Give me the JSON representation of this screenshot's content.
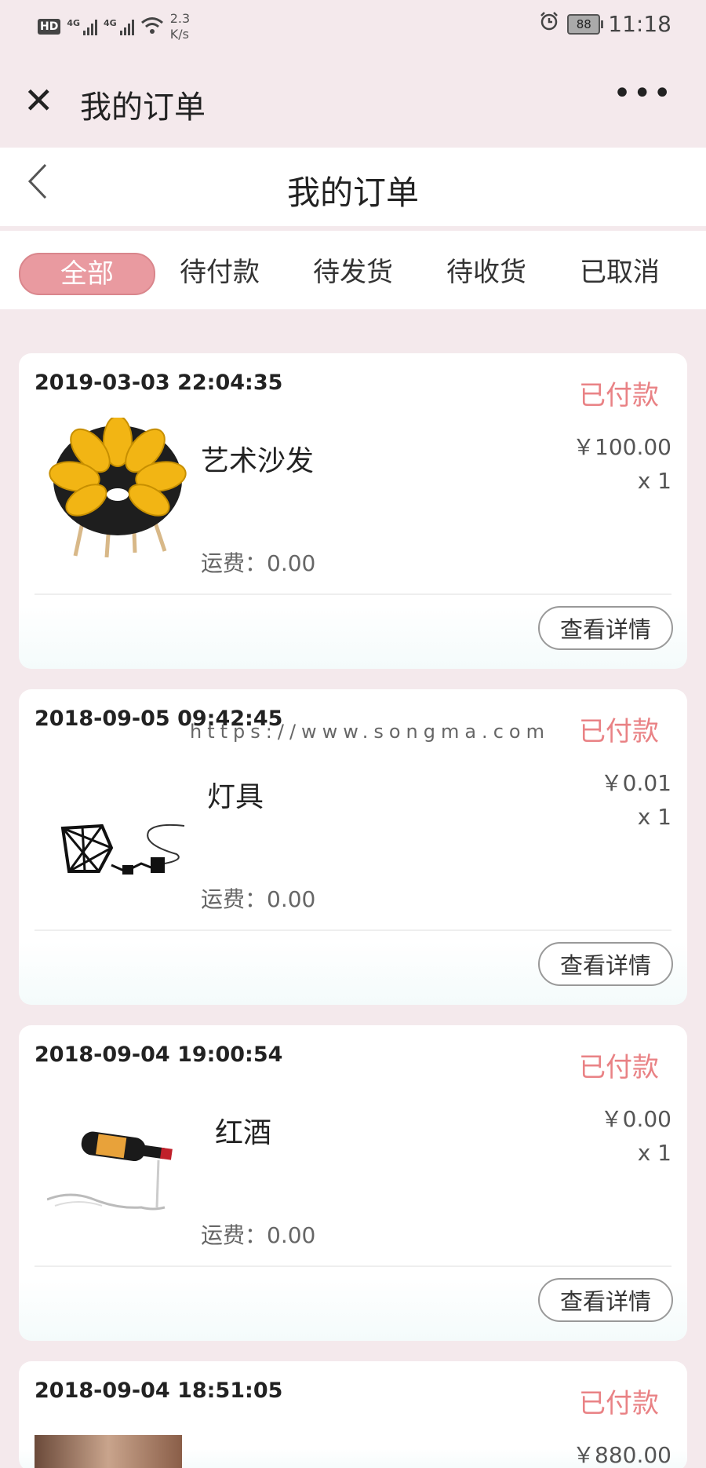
{
  "status_bar": {
    "hd": "HD",
    "net1": "4G",
    "net2": "4G",
    "speed_value": "2.3",
    "speed_unit": "K/s",
    "battery": "88",
    "time": "11:18"
  },
  "wechat_bar": {
    "title": "我的订单"
  },
  "page_header": {
    "title": "我的订单"
  },
  "tabs": [
    {
      "label": "全部",
      "active": true
    },
    {
      "label": "待付款"
    },
    {
      "label": "待发货"
    },
    {
      "label": "待收货"
    },
    {
      "label": "已取消"
    }
  ],
  "orders": [
    {
      "date": "2019-03-03 22:04:35",
      "status": "已付款",
      "name": "艺术沙发",
      "price": "￥100.00",
      "qty": "x 1",
      "shipping": "运费：0.00",
      "button": "查看详情"
    },
    {
      "date": "2018-09-05 09:42:45",
      "status": "已付款",
      "name": "灯具",
      "price": "￥0.01",
      "qty": "x 1",
      "shipping": "运费：0.00",
      "button": "查看详情"
    },
    {
      "date": "2018-09-04 19:00:54",
      "status": "已付款",
      "name": "红酒",
      "price": "￥0.00",
      "qty": "x 1",
      "shipping": "运费：0.00",
      "button": "查看详情"
    },
    {
      "date": "2018-09-04 18:51:05",
      "status": "已付款",
      "price": "￥880.00"
    }
  ],
  "watermark": "https://www.songma.com",
  "colors": {
    "accent": "#e98285",
    "tab_active_bg": "#e99aa0",
    "page_bg": "#f4e9ec"
  },
  "icons": [
    "close-icon",
    "more-icon",
    "back-icon",
    "alarm-icon",
    "wifi-icon",
    "signal-icon",
    "battery-icon"
  ]
}
